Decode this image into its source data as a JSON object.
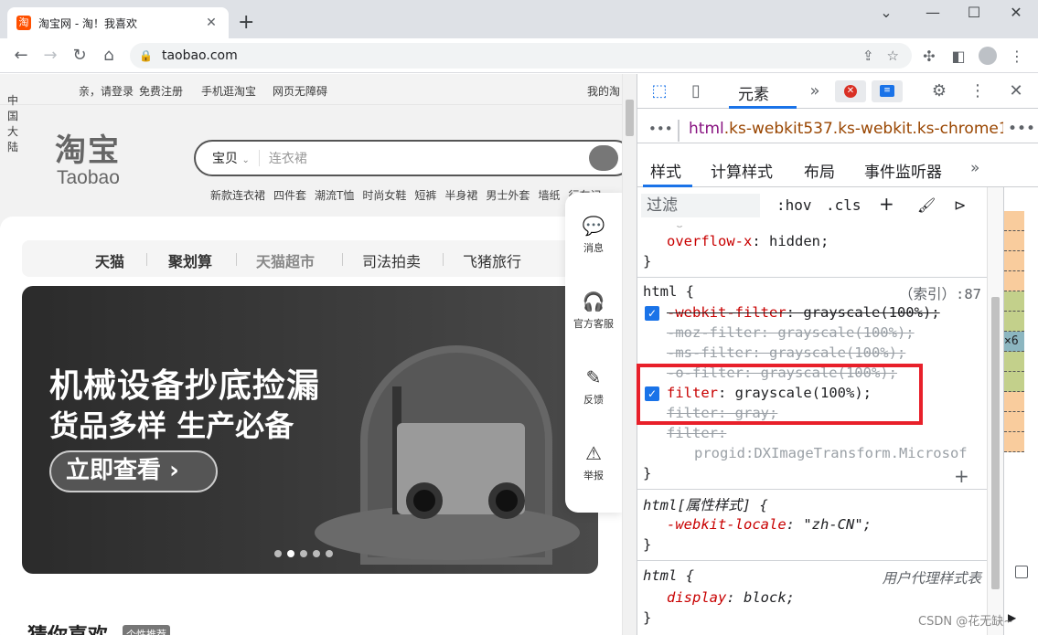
{
  "browser": {
    "tab_title": "淘宝网 - 淘！我喜欢",
    "tab_favicon": "淘",
    "url": "taobao.com"
  },
  "page": {
    "site_nav": {
      "region": "中国大陆",
      "greeting": "亲，请登录",
      "register": "免费注册",
      "mobile": "手机逛淘宝",
      "accessibility": "网页无障碍",
      "my_taobao": "我的淘"
    },
    "logo": {
      "cn": "淘宝",
      "en": "Taobao"
    },
    "search": {
      "category": "宝贝",
      "placeholder": "连衣裙"
    },
    "hot_words": [
      "新款连衣裙",
      "四件套",
      "潮流T恤",
      "时尚女鞋",
      "短裤",
      "半身裙",
      "男士外套",
      "墙纸",
      "行车记"
    ],
    "channels": [
      "天猫",
      "聚划算",
      "天猫超市",
      "司法拍卖",
      "飞猪旅行"
    ],
    "banner": {
      "line1": "机械设备抄底捡漏",
      "line2": "货品多样 生产必备",
      "cta": "立即查看",
      "cta_arrow": "›"
    },
    "guess_title": "猜你喜欢",
    "guess_tag": "个性推荐",
    "side_float": [
      {
        "icon": "message-icon",
        "label": "消息"
      },
      {
        "icon": "headset-icon",
        "label": "官方客服"
      },
      {
        "icon": "feedback-icon",
        "label": "反馈"
      },
      {
        "icon": "warning-icon",
        "label": "举报"
      }
    ]
  },
  "devtools": {
    "main_tab": "元素",
    "breadcrumb_tag": "html",
    "breadcrumb_classes": ".ks-webkit537.ks-webkit.ks-chrome107",
    "subtabs": [
      "样式",
      "计算样式",
      "布局",
      "事件监听器"
    ],
    "filter_placeholder": "过滤",
    "filter_hov": ":hov",
    "filter_cls": ".cls",
    "rules": {
      "partial_line": "overflow-x: hidden;",
      "overflow_prop": "overflow-x",
      "overflow_val": "hidden;",
      "html_selector": "html {",
      "html_source": "（索引）:87",
      "webkit_filter_prop": "-webkit-filter",
      "webkit_filter_val": "grayscale(100%);",
      "moz_filter": "-moz-filter: grayscale(100%);",
      "ms_filter": "-ms-filter: grayscale(100%);",
      "o_filter": "-o-filter: grayscale(100%);",
      "filter_prop": "filter",
      "filter_val": "grayscale(100%);",
      "filter_gray": "filter: gray;",
      "filter_empty": "filter: ",
      "progid": "progid:DXImageTransform.Microsof",
      "close_brace": "}",
      "attr_selector": "html[属性样式] {",
      "locale_prop": "-webkit-locale",
      "locale_val": "\"zh-CN\";",
      "ua_selector": "html {",
      "ua_source": "用户代理样式表",
      "display_prop": "display",
      "display_val": "block;"
    },
    "box_model_label": "×6"
  },
  "watermark": "CSDN @花无缺~"
}
